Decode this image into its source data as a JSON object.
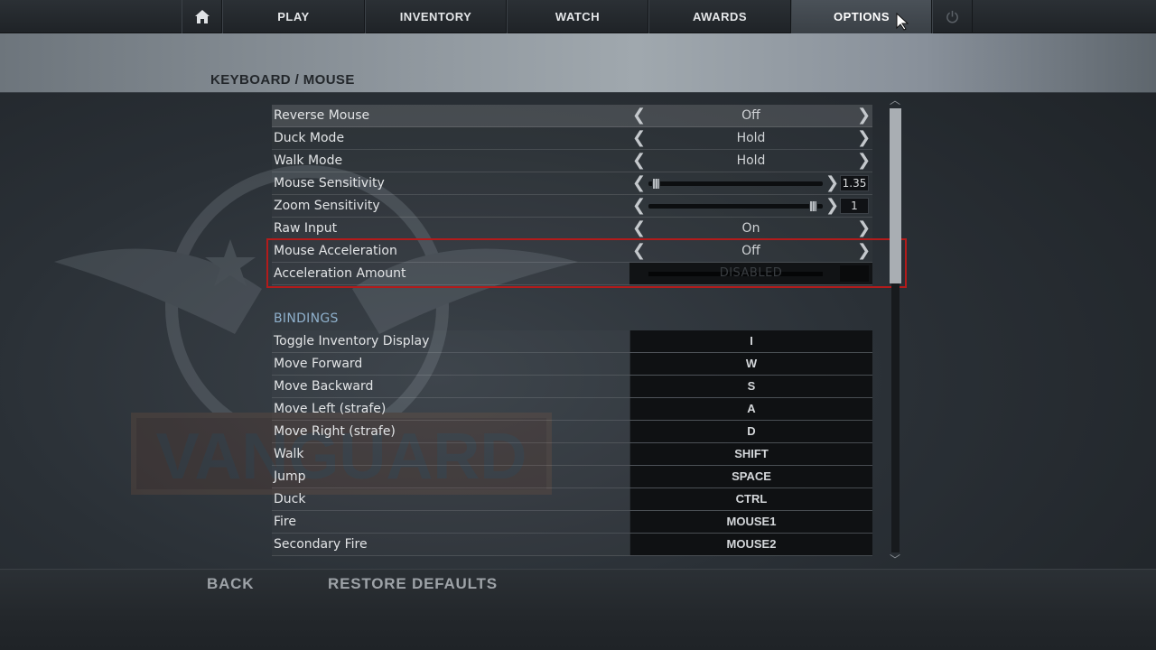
{
  "nav": {
    "home_icon": "home-icon",
    "tabs": [
      {
        "label": "PLAY",
        "active": false
      },
      {
        "label": "INVENTORY",
        "active": false
      },
      {
        "label": "WATCH",
        "active": false
      },
      {
        "label": "AWARDS",
        "active": false
      },
      {
        "label": "OPTIONS",
        "active": true
      }
    ],
    "power_icon": "power-icon"
  },
  "emblem": {
    "text": "VANGUARD"
  },
  "section": {
    "title": "KEYBOARD / MOUSE"
  },
  "settings": [
    {
      "label": "Reverse Mouse",
      "type": "choice",
      "value": "Off",
      "highlighted": true
    },
    {
      "label": "Duck Mode",
      "type": "choice",
      "value": "Hold"
    },
    {
      "label": "Walk Mode",
      "type": "choice",
      "value": "Hold"
    },
    {
      "label": "Mouse Sensitivity",
      "type": "slider",
      "value": "1.35",
      "level": 0.02
    },
    {
      "label": "Zoom Sensitivity",
      "type": "slider",
      "value": "1",
      "level": 0.98
    },
    {
      "label": "Raw Input",
      "type": "choice",
      "value": "On"
    },
    {
      "label": "Mouse Acceleration",
      "type": "choice",
      "value": "Off"
    },
    {
      "label": "Acceleration Amount",
      "type": "disabled",
      "value": "DISABLED"
    }
  ],
  "bindings": {
    "header": "BINDINGS",
    "items": [
      {
        "label": "Toggle Inventory Display",
        "key": "I"
      },
      {
        "label": "Move Forward",
        "key": "W"
      },
      {
        "label": "Move Backward",
        "key": "S"
      },
      {
        "label": "Move Left (strafe)",
        "key": "A"
      },
      {
        "label": "Move Right (strafe)",
        "key": "D"
      },
      {
        "label": "Walk",
        "key": "SHIFT"
      },
      {
        "label": "Jump",
        "key": "SPACE"
      },
      {
        "label": "Duck",
        "key": "CTRL"
      },
      {
        "label": "Fire",
        "key": "MOUSE1"
      },
      {
        "label": "Secondary Fire",
        "key": "MOUSE2"
      }
    ]
  },
  "footer": {
    "back_label": "BACK",
    "restore_label": "RESTORE DEFAULTS"
  },
  "colors": {
    "highlight_border": "#b31b1b",
    "bindings_header": "#8fb0cc",
    "active_tab": "#4a5158"
  }
}
